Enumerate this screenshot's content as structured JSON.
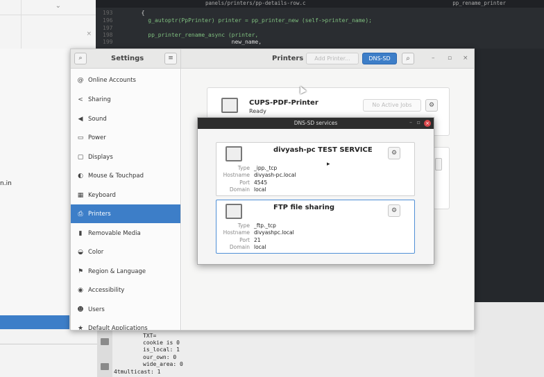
{
  "editor": {
    "path": "panels/printers/pp-details-row.c",
    "function": "pp_rename_printer",
    "lines": [
      {
        "num": "193",
        "code": "  {"
      },
      {
        "num": "196",
        "code": "    g_autoptr(PpPrinter) printer = pp_printer_new (self->printer_name);"
      },
      {
        "num": "197",
        "code": ""
      },
      {
        "num": "198",
        "code": "    pp_printer_rename_async (printer,"
      },
      {
        "num": "199",
        "code": "                             new_name,"
      }
    ]
  },
  "background": {
    "left_text": "n.in"
  },
  "terminal": {
    "lines": [
      "TXT=",
      "cookie is 0",
      "is_local: 1",
      "our_own: 0",
      "wide_area: 0",
      "4tmulticast: 1"
    ]
  },
  "settings": {
    "title": "Settings",
    "panel_title": "Printers",
    "add_printer_label": "Add Printer...",
    "dnssd_label": "DNS-SD",
    "window_controls": {
      "minimize": "–",
      "maximize": "▫",
      "close": "×"
    },
    "sidebar": [
      {
        "label": "Online Accounts",
        "icon": "@"
      },
      {
        "label": "Sharing",
        "icon": "<"
      },
      {
        "label": "Sound",
        "icon": "◀"
      },
      {
        "label": "Power",
        "icon": "▭"
      },
      {
        "label": "Displays",
        "icon": "▢"
      },
      {
        "label": "Mouse & Touchpad",
        "icon": "◐"
      },
      {
        "label": "Keyboard",
        "icon": "▦"
      },
      {
        "label": "Printers",
        "icon": "⎙"
      },
      {
        "label": "Removable Media",
        "icon": "▮"
      },
      {
        "label": "Color",
        "icon": "◒"
      },
      {
        "label": "Region & Language",
        "icon": "⚑"
      },
      {
        "label": "Accessibility",
        "icon": "◉"
      },
      {
        "label": "Users",
        "icon": "☻"
      },
      {
        "label": "Default Applications",
        "icon": "★"
      }
    ],
    "selected_index": 7,
    "printer": {
      "name": "CUPS-PDF-Printer",
      "status": "Ready",
      "jobs_label": "No Active Jobs"
    }
  },
  "dns_dialog": {
    "title": "DNS-SD services",
    "field_labels": {
      "type": "Type",
      "hostname": "Hostname",
      "port": "Port",
      "domain": "Domain"
    },
    "services": [
      {
        "name": "divyash-pc TEST SERVICE",
        "type": "_ipp._tcp",
        "hostname": "divyash-pc.local",
        "port": "4545",
        "domain": "local"
      },
      {
        "name": "FTP file sharing",
        "type": "_ftp._tcp",
        "hostname": "divyashpc.local",
        "port": "21",
        "domain": "local"
      }
    ]
  }
}
